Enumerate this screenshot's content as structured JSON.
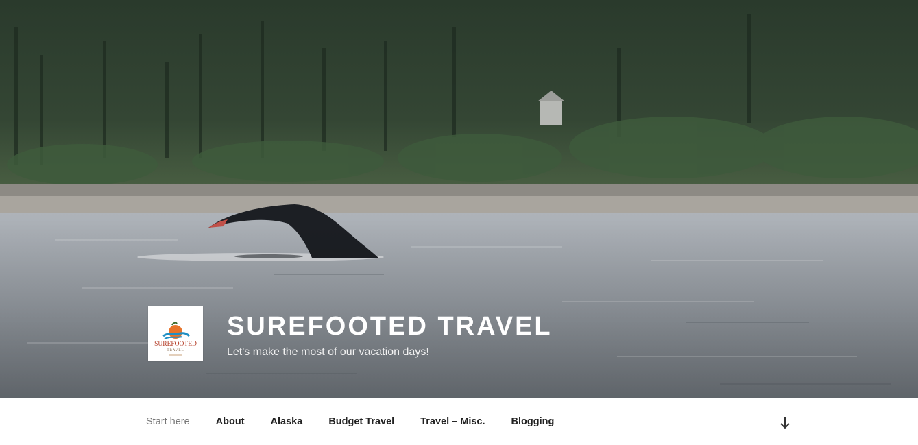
{
  "site": {
    "title": "Surefooted Travel",
    "description": "Let's make the most of our vacation days!",
    "logo": {
      "line1": "SUREFOOTED",
      "line2": "TRAVEL"
    }
  },
  "nav": {
    "items": [
      {
        "label": "Start here",
        "current": true
      },
      {
        "label": "About"
      },
      {
        "label": "Alaska"
      },
      {
        "label": "Budget Travel"
      },
      {
        "label": "Travel – Misc."
      },
      {
        "label": "Blogging"
      }
    ],
    "scroll_icon": "arrow-down-icon"
  },
  "colors": {
    "nav_text": "#222222",
    "nav_current": "#767676",
    "title": "#ffffff"
  }
}
